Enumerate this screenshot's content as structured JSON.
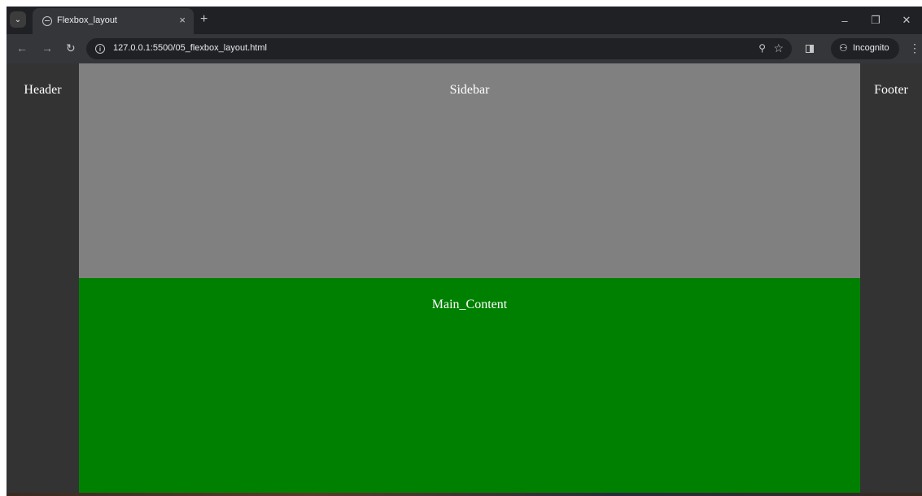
{
  "browser": {
    "tab_title": "Flexbox_layout",
    "tab_close_glyph": "×",
    "new_tab_glyph": "+",
    "url": "127.0.0.1:5500/05_flexbox_layout.html",
    "incognito_label": "Incognito",
    "icons": [
      "tab-search-icon",
      "globe-icon",
      "close-icon",
      "plus-icon",
      "back-arrow-icon",
      "forward-arrow-icon",
      "reload-icon",
      "info-icon",
      "zoom-icon",
      "star-icon",
      "side-panel-icon",
      "incognito-icon",
      "kebab-menu-icon",
      "minimize-icon",
      "restore-icon",
      "window-close-icon"
    ]
  },
  "page": {
    "header_label": "Header",
    "sidebar_label": "Sidebar",
    "main_label": "Main_Content",
    "footer_label": "Footer"
  },
  "colors": {
    "header_footer_bg": "#333333",
    "sidebar_bg": "#808080",
    "main_bg": "#008000",
    "text": "#ffffff"
  }
}
